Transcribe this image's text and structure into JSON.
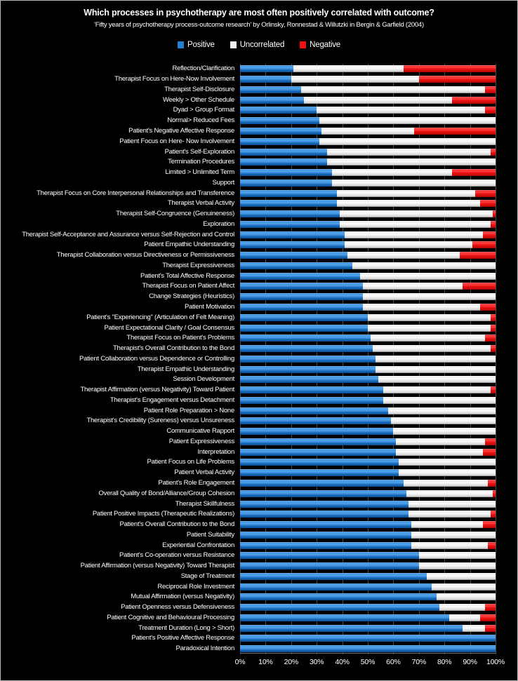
{
  "chart_data": {
    "type": "bar",
    "subtype": "stacked-horizontal-100pct",
    "title": "Which processes in psychotherapy are most often positively correlated with outcome?",
    "subtitle": "'Fifty years of psychotherapy process-outcome research' by Orlinsky, Ronnestad & Willutzki in Bergin & Garfield (2004)",
    "xlabel": "",
    "ylabel": "",
    "xlim": [
      0,
      100
    ],
    "xticks": [
      "0%",
      "10%",
      "20%",
      "30%",
      "40%",
      "50%",
      "60%",
      "70%",
      "80%",
      "90%",
      "100%"
    ],
    "xtick_values": [
      0,
      10,
      20,
      30,
      40,
      50,
      60,
      70,
      80,
      90,
      100
    ],
    "grid": true,
    "legend_position": "top-center",
    "colors": {
      "positive": "#1F7FD4",
      "uncorrelated": "#F2F2F2",
      "negative": "#EE1111",
      "background": "#000000",
      "text": "#FFFFFF",
      "gridline": "#4A4A4A"
    },
    "legend": [
      {
        "name": "Positive",
        "color": "#1F7FD4"
      },
      {
        "name": "Uncorrelated",
        "color": "#F2F2F2"
      },
      {
        "name": "Negative",
        "color": "#EE1111"
      }
    ],
    "series": [
      {
        "name": "Positive",
        "color": "#1F7FD4",
        "values": [
          21,
          20,
          24,
          25,
          30,
          31,
          32,
          31,
          34,
          34,
          36,
          36,
          38,
          38,
          39,
          39,
          41,
          41,
          42,
          44,
          47,
          48,
          48,
          48,
          50,
          50,
          51,
          52,
          53,
          53,
          54,
          56,
          56,
          58,
          59,
          60,
          61,
          61,
          62,
          62,
          64,
          65,
          66,
          66,
          67,
          67,
          67,
          70,
          70,
          73,
          75,
          77,
          78,
          82,
          87,
          100,
          100
        ]
      },
      {
        "name": "Uncorrelated",
        "color": "#F2F2F2",
        "values": [
          43,
          50,
          72,
          58,
          66,
          69,
          36,
          69,
          64,
          66,
          47,
          64,
          54,
          56,
          60,
          59,
          54,
          50,
          44,
          56,
          53,
          39,
          52,
          46,
          48,
          48,
          45,
          46,
          47,
          47,
          46,
          42,
          44,
          42,
          41,
          40,
          35,
          34,
          38,
          38,
          33,
          34,
          34,
          32,
          28,
          33,
          30,
          30,
          30,
          27,
          25,
          23,
          18,
          12,
          9,
          0,
          0
        ]
      },
      {
        "name": "Negative",
        "color": "#EE1111",
        "values": [
          36,
          30,
          4,
          17,
          4,
          0,
          32,
          0,
          2,
          0,
          17,
          0,
          8,
          6,
          1,
          2,
          5,
          9,
          14,
          0,
          0,
          13,
          0,
          6,
          2,
          2,
          4,
          2,
          0,
          0,
          0,
          2,
          0,
          0,
          0,
          0,
          4,
          5,
          0,
          0,
          3,
          1,
          0,
          2,
          5,
          0,
          3,
          0,
          0,
          0,
          0,
          0,
          4,
          6,
          4,
          0,
          0
        ]
      }
    ],
    "categories": [
      "Reflection/Clarification",
      "Therapist Focus on Here-Now Involvement",
      "Therapist Self-Disclosure",
      "Weekly > Other Schedule",
      "Dyad > Group Format",
      "Normal> Reduced Fees",
      "Patient's Negative Affective Response",
      "Patient Focus on Here- Now Involvement",
      "Patient's Self-Exploration",
      "Termination Procedures",
      "Limited > Unlimited Term",
      "Support",
      "Therapist Focus on Core Interpersonal Relationships and Transference",
      "Therapist Verbal Activity",
      "Therapist Self-Congruence (Genuineness)",
      "Exploration",
      "Therapist Self-Acceptance and Assurance versus Self-Rejection and Control",
      "Patient Empathic Understanding",
      "Therapist Collaboration versus Directiveness or Permissiveness",
      "Therapist Expressiveness",
      "Patient's Total Affective Response",
      "Therapist Focus on Patient Affect",
      "Change Strategies (Heuristics)",
      "Patient Motivation",
      "Patient's \"Experiencing\" (Articulation of Felt Meaning)",
      "Patient Expectational Clarity / Goal Consensus",
      "Therapist Focus on Patient's Problems",
      "Therapist's Overall Contribution to the Bond",
      "Patient Collaboration versus Dependence or Controlling",
      "Therapist Empathic Understanding",
      "Session Development",
      "Therapist Affirmation (versus Negativity) Toward Patient",
      "Therapist's Engagement versus Detachment",
      "Patient Role Preparation > None",
      "Therapist's Credibility (Sureness) versus Unsureness",
      "Communicative Rapport",
      "Patient Expressiveness",
      "Interpretation",
      "Patient Focus on Life Problems",
      "Patient Verbal Activity",
      "Patient's Role Engagement",
      "Overall Quality of Bond/Alliance/Group Cohesion",
      "Therapist Skillfulness",
      "Patient Positive Impacts (Therapeutic Realizations)",
      "Patient's Overall Contribution to the Bond",
      "Patient Suitability",
      "Experiential Confrontation",
      "Patient's Co-operation versus Resistance",
      "Patient Affirmation (versus Negativity) Toward Therapist",
      "Stage of Treatment",
      "Reciprocal Role Investment",
      "Mutual Affirmation (versus Negativity)",
      "Patient Openness versus Defensiveness",
      "Patient Cognitive and Behavioural Processing",
      "Treatment Duration (Long > Short)",
      "Patient's Positive Affective Response",
      "Paradoxical Intention"
    ]
  }
}
